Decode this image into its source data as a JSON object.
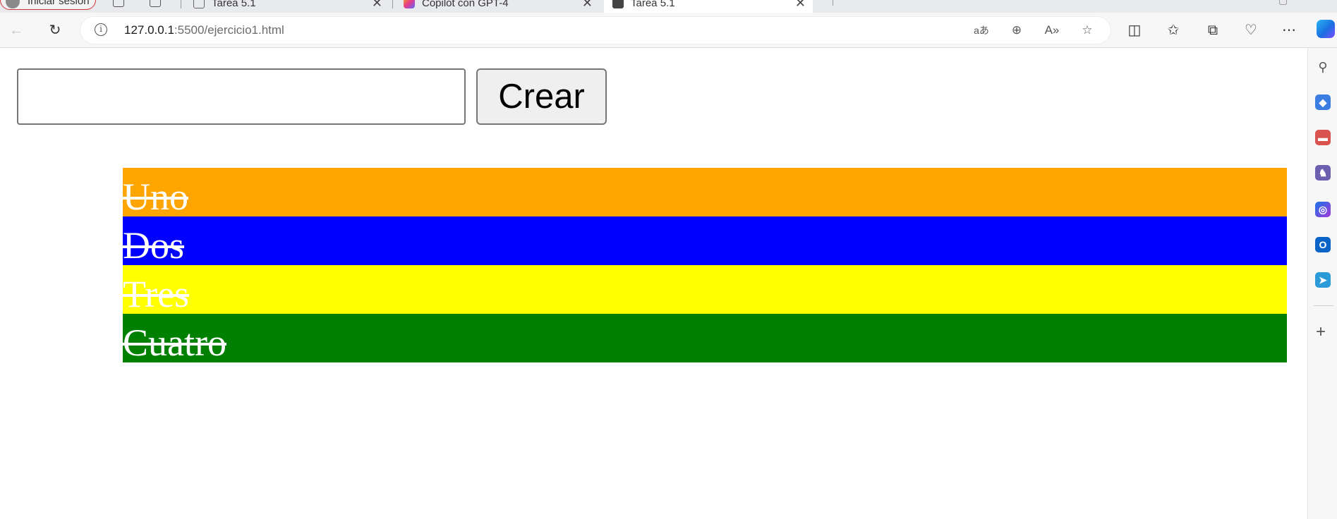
{
  "browser": {
    "profile_label": "Iniciar sesión",
    "tabs": [
      {
        "title": "Tarea 5.1",
        "icon": "page-icon"
      },
      {
        "title": "Copilot con GPT-4",
        "icon": "copilot-icon"
      },
      {
        "title": "Tarea 5.1",
        "icon": "page-icon",
        "active": true
      }
    ],
    "new_tab": "+",
    "tab_close": "✕",
    "address": {
      "host": "127.0.0.1",
      "path": ":5500/ejercicio1.html"
    },
    "toolbar_icons": [
      "back-icon",
      "refresh-icon",
      "translate-icon",
      "zoom-icon",
      "read-aloud-icon",
      "favorite-icon",
      "split-screen-icon",
      "favorites-icon",
      "collections-icon",
      "browser-essentials-icon",
      "more-icon"
    ],
    "sidebar_icons": [
      "search-icon",
      "shopping-icon",
      "tools-icon",
      "games-icon",
      "microsoft365-icon",
      "outlook-icon",
      "telegram-icon",
      "add-icon"
    ]
  },
  "page": {
    "input": {
      "value": "",
      "placeholder": ""
    },
    "button_label": "Crear",
    "items": [
      {
        "label": "Uno",
        "color": "#ffa500"
      },
      {
        "label": "Dos",
        "color": "#0000ff"
      },
      {
        "label": "Tres",
        "color": "#ffff00"
      },
      {
        "label": "Cuatro",
        "color": "#008000"
      }
    ]
  }
}
